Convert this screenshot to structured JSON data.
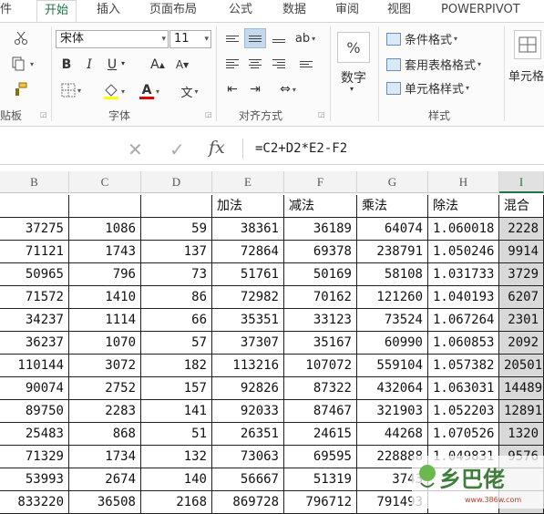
{
  "tabs": [
    {
      "label": "件",
      "active": false
    },
    {
      "label": "开始",
      "active": true
    },
    {
      "label": "插入",
      "active": false
    },
    {
      "label": "页面布局",
      "active": false
    },
    {
      "label": "公式",
      "active": false
    },
    {
      "label": "数据",
      "active": false
    },
    {
      "label": "审阅",
      "active": false
    },
    {
      "label": "视图",
      "active": false
    },
    {
      "label": "POWERPIVOT",
      "active": false
    }
  ],
  "ribbon": {
    "font_name": "宋体",
    "font_size": "11",
    "groups": {
      "clipboard": "贴板",
      "font": "字体",
      "alignment": "对齐方式",
      "number": "数字",
      "styles": "样式"
    },
    "number_format_button": "数字",
    "styles_buttons": [
      "条件格式",
      "套用表格格式",
      "单元格样式"
    ],
    "cells_button": "单元格",
    "bold": "B",
    "italic": "I",
    "underline": "U",
    "grow_font": "A",
    "shrink_font": "A",
    "font_color": "A",
    "percent": "%"
  },
  "formula_bar": {
    "cancel": "✕",
    "enter": "✓",
    "fx": "fx",
    "formula": "=C2+D2*E2-F2"
  },
  "grid": {
    "columns": [
      "B",
      "C",
      "D",
      "E",
      "F",
      "G",
      "H",
      "I"
    ],
    "selected_column": "I",
    "header_row": [
      "",
      "",
      "",
      "加法",
      "减法",
      "乘法",
      "除法",
      "混合"
    ],
    "rows": [
      [
        "37275",
        "1086",
        "59",
        "38361",
        "36189",
        "64074",
        "1.060018",
        "2228"
      ],
      [
        "71121",
        "1743",
        "137",
        "72864",
        "69378",
        "238791",
        "1.050246",
        "9914"
      ],
      [
        "50965",
        "796",
        "73",
        "51761",
        "50169",
        "58108",
        "1.031733",
        "3729"
      ],
      [
        "71572",
        "1410",
        "86",
        "72982",
        "70162",
        "121260",
        "1.040193",
        "6207"
      ],
      [
        "34237",
        "1114",
        "66",
        "35351",
        "33123",
        "73524",
        "1.067264",
        "2301"
      ],
      [
        "36237",
        "1070",
        "57",
        "37307",
        "35167",
        "60990",
        "1.060853",
        "2092"
      ],
      [
        "110144",
        "3072",
        "182",
        "113216",
        "107072",
        "559104",
        "1.057382",
        "20501"
      ],
      [
        "90074",
        "2752",
        "157",
        "92826",
        "87322",
        "432064",
        "1.063031",
        "14489"
      ],
      [
        "89750",
        "2283",
        "141",
        "92033",
        "87467",
        "321903",
        "1.052203",
        "12891"
      ],
      [
        "25483",
        "868",
        "51",
        "26351",
        "24615",
        "44268",
        "1.070526",
        "1320"
      ],
      [
        "71329",
        "1734",
        "132",
        "73063",
        "69595",
        "228888",
        "1.049831",
        "9576"
      ],
      [
        "53993",
        "2674",
        "140",
        "56667",
        "51319",
        "3743",
        "",
        ""
      ],
      [
        "833220",
        "36508",
        "2168",
        "869728",
        "796712",
        "791493",
        "",
        ""
      ]
    ]
  },
  "watermark": {
    "text": "乡巴佬",
    "url": "www.386w.com"
  },
  "colors": {
    "accent": "#217346",
    "selection": "#d9d9d9"
  }
}
